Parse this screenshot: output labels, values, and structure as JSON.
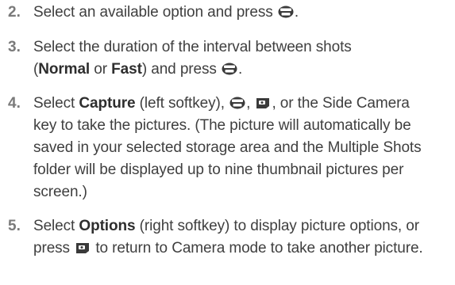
{
  "steps": [
    {
      "number": "2.",
      "line1": "Select an available option and press",
      "tail": "."
    },
    {
      "number": "3.",
      "line1": "Select the duration of the interval between shots",
      "open_paren": "(",
      "normal": "Normal",
      "or": " or ",
      "fast": "Fast",
      "mid": ") and press",
      "tail": "."
    },
    {
      "number": "4.",
      "select": "Select ",
      "capture": "Capture",
      "capture_rest": " (left softkey), ",
      "comma1": ", ",
      "comma2": ", or the Side Camera",
      "rest": "key to take the pictures. (The picture will automatically be saved in your selected storage area and the Multiple Shots folder will be displayed up to nine thumbnail pictures per screen.)"
    },
    {
      "number": "5.",
      "select": "Select ",
      "options": "Options",
      "options_rest": " (right softkey) to display picture options, or press",
      "rest": " to return to Camera mode to take another picture."
    }
  ],
  "icons": {
    "menu_ok_key": "menu-ok-key-icon",
    "camera_key": "camera-key-icon"
  },
  "colors": {
    "step_number": "#7a7a7a",
    "body_text": "#3f3f3f",
    "key_fill": "#3a3a3a"
  }
}
